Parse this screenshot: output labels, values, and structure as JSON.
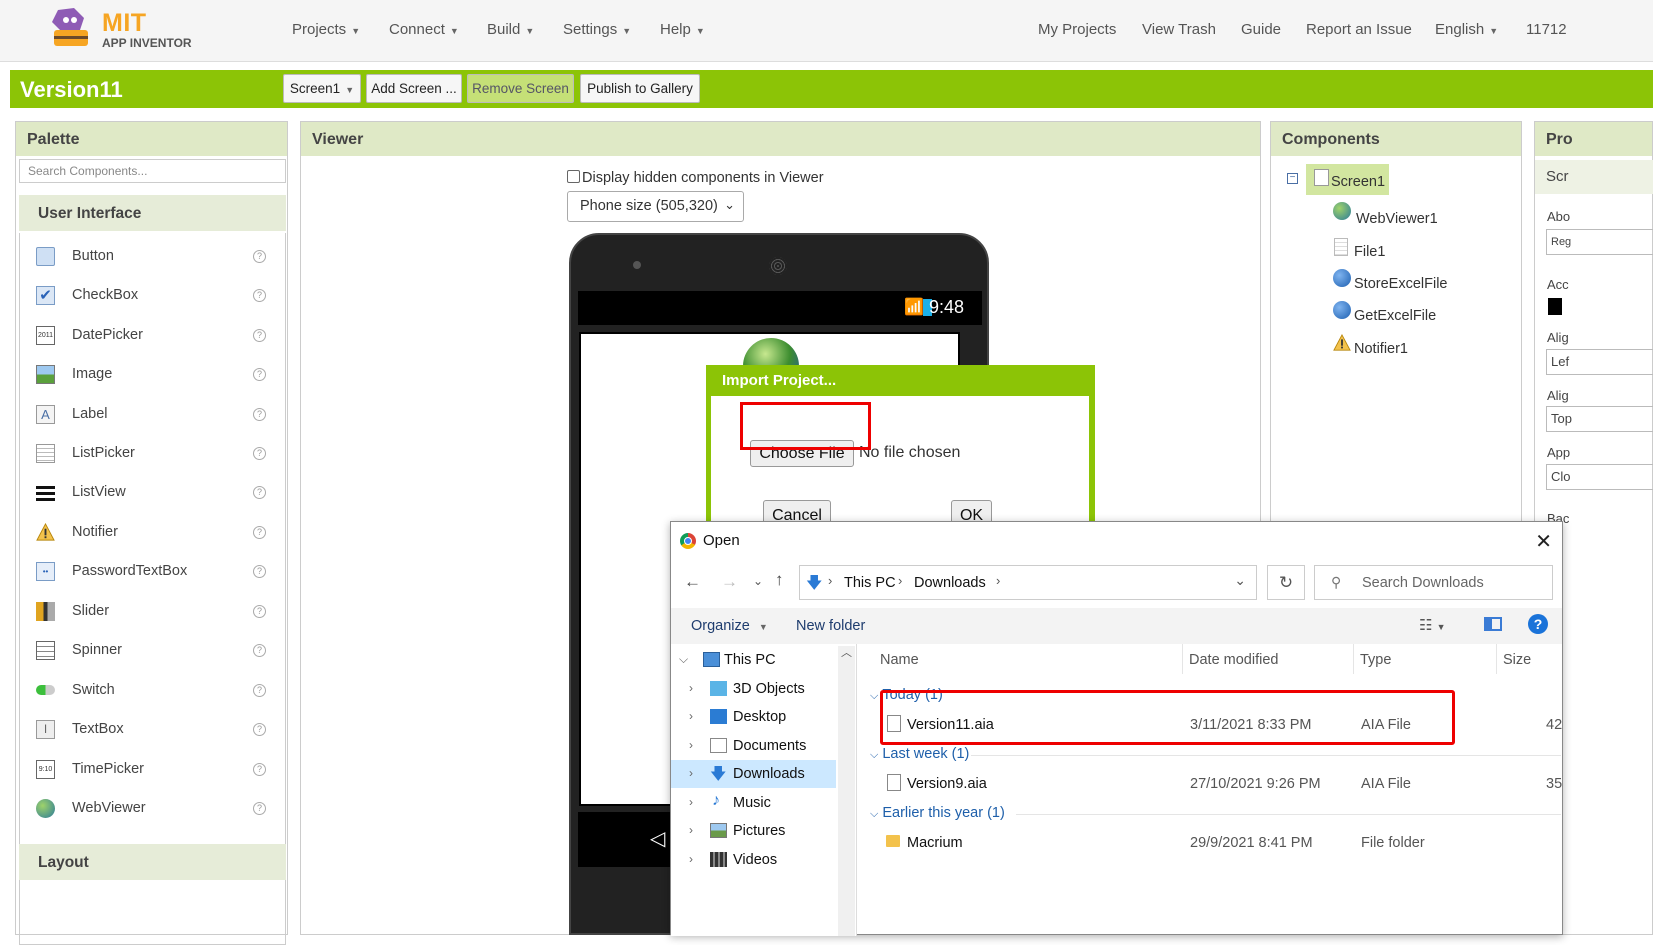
{
  "topnav": {
    "logo_line1": "MIT",
    "logo_line2": "APP INVENTOR",
    "menus": [
      "Projects",
      "Connect",
      "Build",
      "Settings",
      "Help"
    ],
    "links": [
      "My Projects",
      "View Trash",
      "Guide",
      "Report an Issue",
      "English",
      "11712"
    ]
  },
  "toolbar": {
    "project_name": "Version11",
    "screen_select": "Screen1",
    "add_screen": "Add Screen ...",
    "remove_screen": "Remove Screen",
    "publish": "Publish to Gallery"
  },
  "palette": {
    "title": "Palette",
    "search_placeholder": "Search Components...",
    "section": "User Interface",
    "items": [
      "Button",
      "CheckBox",
      "DatePicker",
      "Image",
      "Label",
      "ListPicker",
      "ListView",
      "Notifier",
      "PasswordTextBox",
      "Slider",
      "Spinner",
      "Switch",
      "TextBox",
      "TimePicker",
      "WebViewer"
    ],
    "help_glyph": "?",
    "layout_section": "Layout"
  },
  "viewer": {
    "title": "Viewer",
    "hidden_checkbox_label": "Display hidden components in Viewer",
    "phone_size": "Phone size (505,320)",
    "status_time": "9:48"
  },
  "import_dialog": {
    "title": "Import Project...",
    "choose_file": "Choose File",
    "no_file": "No file chosen",
    "cancel": "Cancel",
    "ok": "OK"
  },
  "components": {
    "title": "Components",
    "items": [
      "Screen1",
      "WebViewer1",
      "File1",
      "StoreExcelFile",
      "GetExcelFile",
      "Notifier1"
    ]
  },
  "properties": {
    "title": "Pro",
    "labels": [
      "Scr",
      "Abo",
      "Reg",
      "Acc",
      "Alig",
      "Lef",
      "Alig",
      "Top",
      "App",
      "Clo",
      "Bac"
    ]
  },
  "open_dialog": {
    "title": "Open",
    "path": [
      "This PC",
      "Downloads"
    ],
    "search_placeholder": "Search Downloads",
    "organize": "Organize",
    "new_folder": "New folder",
    "help_glyph": "?",
    "nav": [
      "This PC",
      "3D Objects",
      "Desktop",
      "Documents",
      "Downloads",
      "Music",
      "Pictures",
      "Videos"
    ],
    "columns": [
      "Name",
      "Date modified",
      "Type",
      "Size"
    ],
    "groups": [
      "Today (1)",
      "Last week (1)",
      "Earlier this year (1)"
    ],
    "files": [
      {
        "name": "Version11.aia",
        "date": "3/11/2021 8:33 PM",
        "type": "AIA File",
        "size": "42"
      },
      {
        "name": "Version9.aia",
        "date": "27/10/2021 9:26 PM",
        "type": "AIA File",
        "size": "35"
      },
      {
        "name": "Macrium",
        "date": "29/9/2021 8:41 PM",
        "type": "File folder",
        "size": ""
      }
    ]
  },
  "colors": {
    "brand_green": "#8cc406",
    "panel_header": "#dfe9c6",
    "highlight_red": "#e00000",
    "selection_blue": "#cce8ff"
  }
}
